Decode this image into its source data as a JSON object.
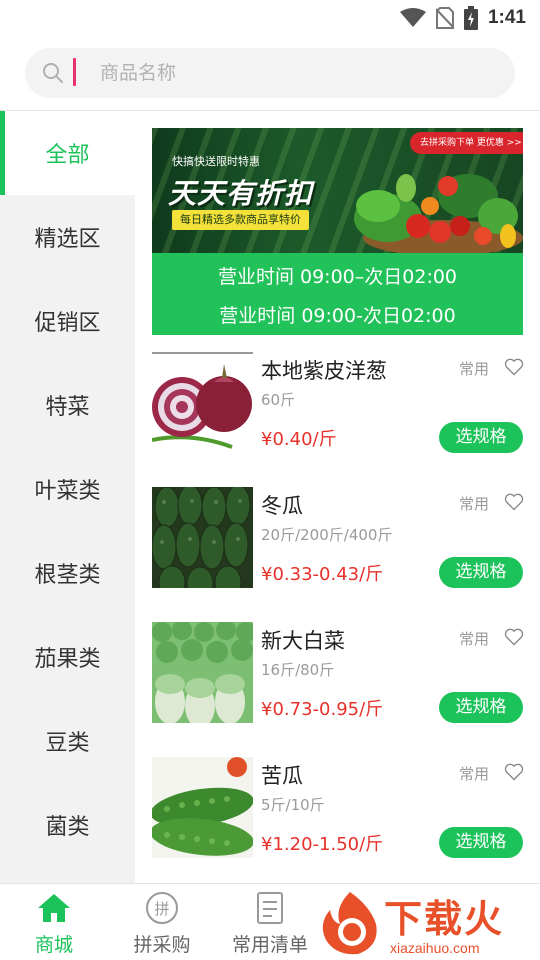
{
  "status_bar": {
    "time": "1:41"
  },
  "search": {
    "placeholder": "商品名称"
  },
  "sidebar": {
    "items": [
      {
        "label": "全部",
        "active": true
      },
      {
        "label": "精选区"
      },
      {
        "label": "促销区"
      },
      {
        "label": "特菜"
      },
      {
        "label": "叶菜类"
      },
      {
        "label": "根茎类"
      },
      {
        "label": "茄果类"
      },
      {
        "label": "豆类"
      },
      {
        "label": "菌类"
      }
    ]
  },
  "banner": {
    "small_text": "快搞快送限时特惠",
    "headline": "天天有折扣",
    "tag": "每日精选多款商品享特价",
    "pill": "去拼采购下单 更优惠 >>",
    "hours_1": "营业时间  09:00–次日02:00",
    "hours_2": "营业时间  09:00-次日02:00"
  },
  "products": [
    {
      "name": "本地紫皮洋葱",
      "tag": "常用",
      "spec": "60斤",
      "price": "¥0.40/斤",
      "button": "选规格",
      "image": "red-onion"
    },
    {
      "name": "冬瓜",
      "tag": "常用",
      "spec": "20斤/200斤/400斤",
      "price": "¥0.33-0.43/斤",
      "button": "选规格",
      "image": "winter-melon"
    },
    {
      "name": "新大白菜",
      "tag": "常用",
      "spec": "16斤/80斤",
      "price": "¥0.73-0.95/斤",
      "button": "选规格",
      "image": "chinese-cabbage"
    },
    {
      "name": "苦瓜",
      "tag": "常用",
      "spec": "5斤/10斤",
      "price": "¥1.20-1.50/斤",
      "button": "选规格",
      "image": "bitter-melon"
    }
  ],
  "bottom_nav": {
    "items": [
      {
        "label": "商城",
        "icon": "home-icon",
        "active": true
      },
      {
        "label": "拼采购",
        "icon": "group-buy-icon"
      },
      {
        "label": "常用清单",
        "icon": "list-icon"
      }
    ]
  },
  "watermark": {
    "title": "下载火",
    "url": "xiazaihuo.com"
  },
  "colors": {
    "accent": "#1cc25a",
    "price": "#e8312b",
    "sidebar_bg": "#f2f2f2"
  }
}
